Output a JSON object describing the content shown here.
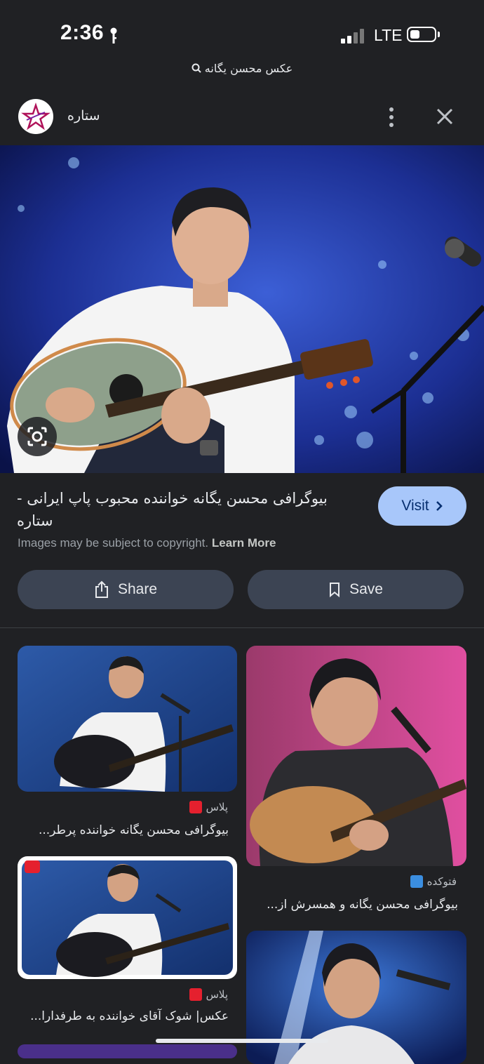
{
  "status_bar": {
    "time": "2:36",
    "network": "LTE"
  },
  "search_query": "عکس محسن یگانه",
  "source": {
    "name": "ستاره"
  },
  "result": {
    "title": "بیوگرافی محسن یگانه خواننده محبوب پاپ ایرانی - ستاره",
    "visit_label": "Visit",
    "copyright_text": "Images may be subject to copyright.",
    "learn_more": "Learn More",
    "share_label": "Share",
    "save_label": "Save"
  },
  "related": [
    {
      "source": "پلاس",
      "title": "بیوگرافی محسن یگانه خواننده پرطر...",
      "favicon_color": "#e5202e"
    },
    {
      "source": "فتوکده",
      "title": "بیوگرافی محسن یگانه و همسرش از...",
      "favicon_color": "#3b8ee0"
    },
    {
      "source": "پلاس",
      "title": "عکس| شوک آقای خواننده به طرفدارا...",
      "favicon_color": "#e5202e"
    }
  ],
  "colors": {
    "background": "#202124",
    "visit_button": "#a8c7fa",
    "action_button": "#3c4453"
  }
}
